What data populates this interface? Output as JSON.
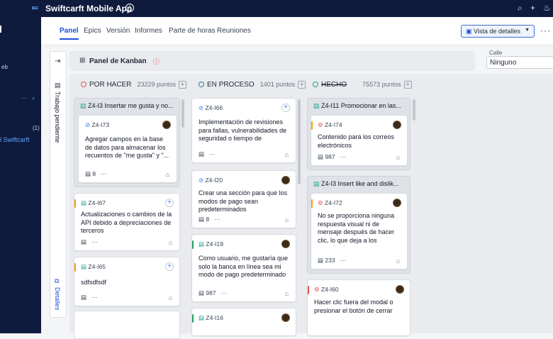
{
  "app": {
    "title": "Swiftcarft Mobile App"
  },
  "leftnav": {
    "eb": "eb",
    "count": "(1)",
    "project": "l Swiftcarft"
  },
  "tabs": [
    "Panel",
    "Epics",
    "Versión",
    "Informes",
    "Parte de horas",
    "Reuniones"
  ],
  "view_button": "Vista de detalles",
  "side": {
    "pending": "Trabajo pendiente",
    "details": "Detalles"
  },
  "kanban_title": "Panel de Kanban",
  "street": {
    "label": "Calle",
    "value": "Ninguno"
  },
  "columns": [
    {
      "name": "POR HACER",
      "points": "23229 puntos",
      "color": "#e05252"
    },
    {
      "name": "EN PROCESO",
      "points": "1401 puntos",
      "color": "#2b7a9e"
    },
    {
      "name": "HECHO",
      "points": "75573 puntos",
      "color": "#21a08a"
    }
  ],
  "cards": {
    "g1_head": "Z4-I3  Insertar me gusta y no...",
    "c173_key": "Z4-I73",
    "c173_text": "Agregar campos en la base de datos para almacenar los recuentos de \"me gusta\" y \"...",
    "c173_count": "8",
    "c167_key": "Z4-I67",
    "c167_text": "Actualizaciones o cambios de la API debido a depreciaciones de terceros",
    "c165_key": "Z4-I65",
    "c165_text": "sdfsdfsdf",
    "c166_key": "Z4-I66",
    "c166_text": "Implementación de revisiones para fallas, vulnerabilidades de seguridad o tiempo de",
    "c120_key": "Z4-I20",
    "c120_text": "Crear una sección para que los modos de pago sean predeterminados",
    "c120_count": "8",
    "c119_key": "Z4-I19",
    "c119_text": "Como usuario, me gustaría que solo la banca en línea sea mi modo de pago predeterminado",
    "c119_count": "987",
    "c1xx_key": "Z4-I16",
    "g2_head": "Z4-I11  Promocionar en las...",
    "c174_key": "Z4-I74",
    "c174_text": "Contenido para los correos electrónicos",
    "c174_count": "987",
    "g3_head": "Z4-I3  Insert like and dislik...",
    "c172_key": "Z4-I72",
    "c172_text": "No se proporciona ninguna respuesta visual ni de mensaje después de hacer clic, lo que deja a los usuarios inseguros...",
    "c172_count": "233",
    "c160_key": "Z4-I60",
    "c160_text": "Hacer clic fuera del modal o presionar el botón de cerrar"
  },
  "icons": [
    "toggle-icon",
    "info-icon",
    "search-icon",
    "plus-icon",
    "bell-icon",
    "more-icon",
    "arrow-in-icon",
    "kanban-icon",
    "alert-icon",
    "subtask-icon",
    "story-icon",
    "bug-icon",
    "tag-icon"
  ]
}
